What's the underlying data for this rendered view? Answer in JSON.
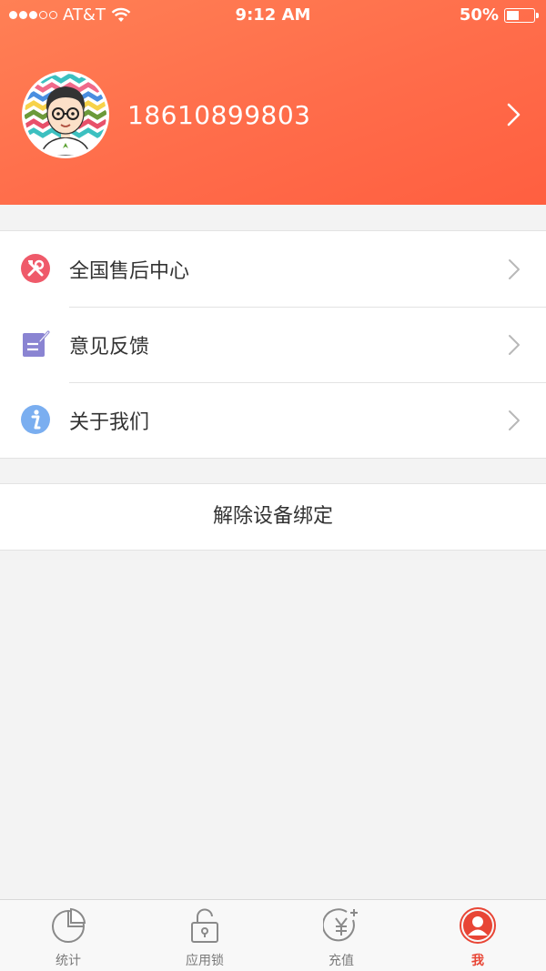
{
  "status_bar": {
    "carrier": "AT&T",
    "time": "9:12 AM",
    "battery": "50%",
    "battery_level": 0.5,
    "signal_bars_filled": 3,
    "signal_bars_total": 5
  },
  "profile": {
    "phone": "18610899803"
  },
  "menu": {
    "items": [
      {
        "label": "全国售后中心",
        "icon": "tools-icon",
        "color": "#ef5a6a"
      },
      {
        "label": "意见反馈",
        "icon": "feedback-icon",
        "color": "#8a84d2"
      },
      {
        "label": "关于我们",
        "icon": "info-icon",
        "color": "#7aaef0"
      }
    ]
  },
  "unbind_label": "解除设备绑定",
  "tabbar": {
    "tabs": [
      {
        "label": "统计",
        "icon": "pie-chart-icon"
      },
      {
        "label": "应用锁",
        "icon": "lock-icon"
      },
      {
        "label": "充值",
        "icon": "yuan-coin-icon"
      },
      {
        "label": "我",
        "icon": "user-icon",
        "active": true
      }
    ]
  },
  "colors": {
    "header_gradient_start": "#ff8055",
    "header_gradient_end": "#ff5f40",
    "active_tab": "#e84535",
    "inactive_tab": "#7a7a7a"
  }
}
